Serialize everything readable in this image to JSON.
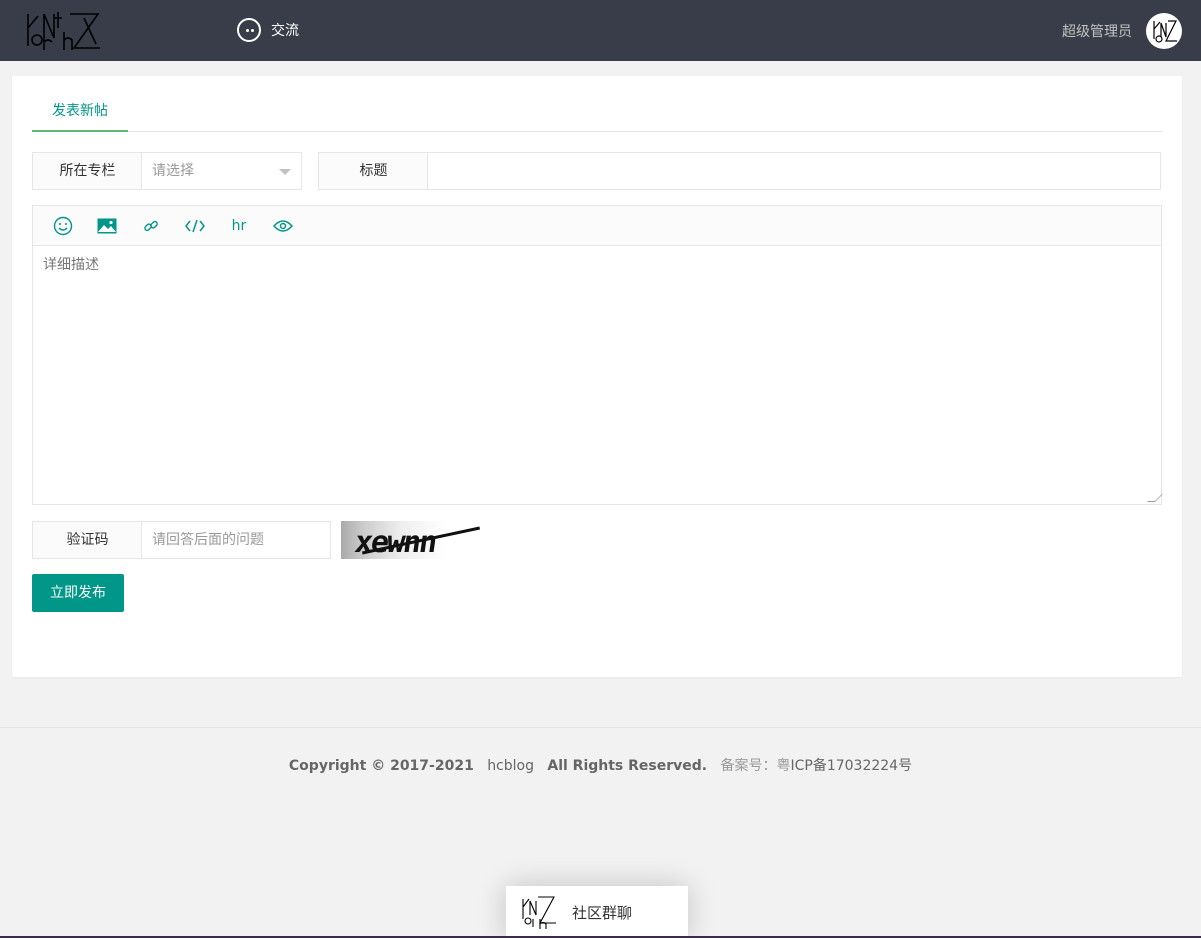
{
  "header": {
    "nav_label": "交流",
    "user_name": "超级管理员"
  },
  "tabs": [
    {
      "label": "发表新帖"
    }
  ],
  "form": {
    "column_label": "所在专栏",
    "column_placeholder": "请选择",
    "title_label": "标题",
    "title_value": "",
    "editor_tools": [
      "emoji-icon",
      "image-icon",
      "link-icon",
      "code-icon",
      "hr",
      "preview-icon"
    ],
    "hr_label": "hr",
    "description_placeholder": "详细描述",
    "captcha_label": "验证码",
    "captcha_placeholder": "请回答后面的问题",
    "captcha_text": "xewnn",
    "submit_label": "立即发布"
  },
  "footer": {
    "copyright": "Copyright © 2017-2021",
    "site": "hcblog",
    "rights": "All Rights Reserved.",
    "icp_label": "备案号：",
    "icp_prefix": "粤",
    "icp_number": "ICP备17032224号"
  },
  "chat_widget": {
    "label": "社区群聊"
  },
  "colors": {
    "header_bg": "#393d49",
    "accent": "#009688",
    "tab_underline": "#5fb878"
  }
}
